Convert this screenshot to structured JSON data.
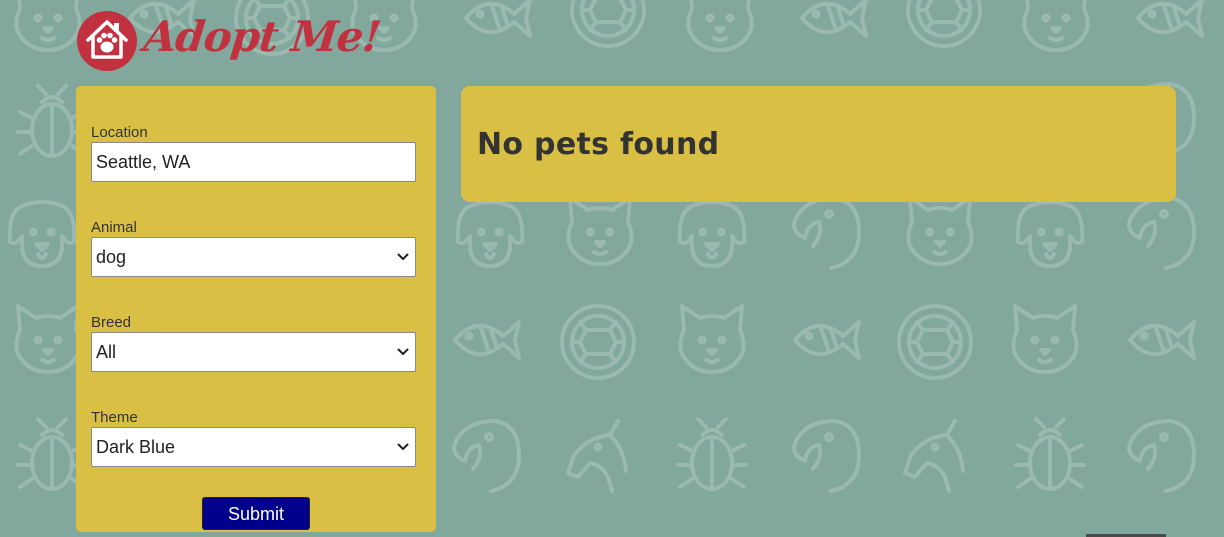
{
  "brand": {
    "name": "Adopt Me!",
    "icon": "house-paw-icon",
    "color": "#c1313f"
  },
  "search_form": {
    "location": {
      "label": "Location",
      "value": "Seattle, WA"
    },
    "animal": {
      "label": "Animal",
      "selected": "dog"
    },
    "breed": {
      "label": "Breed",
      "selected": "All"
    },
    "theme": {
      "label": "Theme",
      "selected": "Dark Blue"
    },
    "submit_label": "Submit"
  },
  "results": {
    "empty_message": "No pets found"
  },
  "colors": {
    "background": "#82a79c",
    "panel": "#d9c045",
    "submit_button": "#00008b",
    "text": "#333333"
  },
  "background_pattern_icons": [
    "cat-icon",
    "fish-icon",
    "turtle-icon",
    "dog-icon",
    "parrot-icon",
    "horse-icon",
    "beetle-icon"
  ]
}
